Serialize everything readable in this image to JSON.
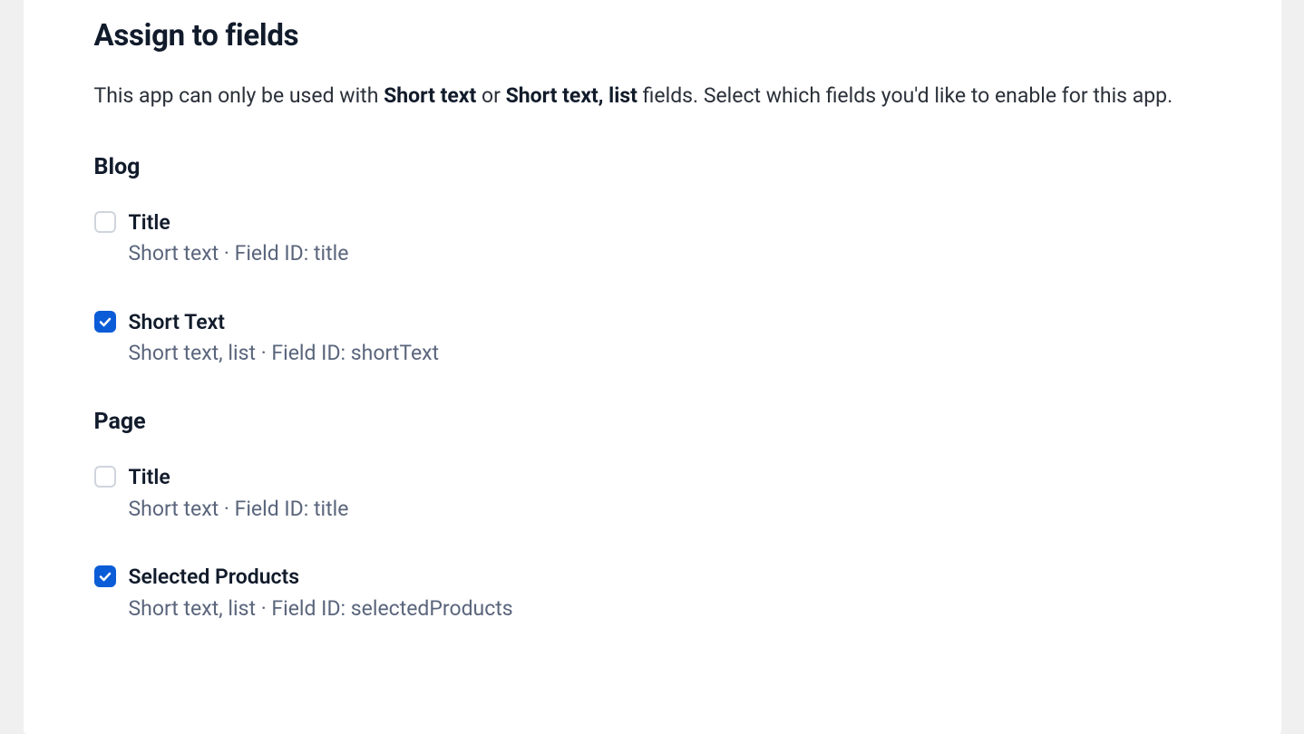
{
  "heading": "Assign to fields",
  "description": {
    "prefix": "This app can only be used with ",
    "bold1": "Short text",
    "mid": " or ",
    "bold2": "Short text, list",
    "suffix": " fields. Select which fields you'd like to enable for this app."
  },
  "groups": [
    {
      "name": "Blog",
      "fields": [
        {
          "checked": false,
          "label": "Title",
          "meta": "Short text · Field ID: title"
        },
        {
          "checked": true,
          "label": "Short Text",
          "meta": "Short text, list · Field ID: shortText"
        }
      ]
    },
    {
      "name": "Page",
      "fields": [
        {
          "checked": false,
          "label": "Title",
          "meta": "Short text · Field ID: title"
        },
        {
          "checked": true,
          "label": "Selected Products",
          "meta": "Short text, list · Field ID: selectedProducts"
        }
      ]
    }
  ]
}
